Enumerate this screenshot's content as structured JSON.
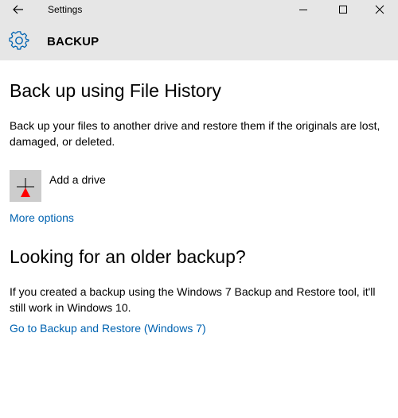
{
  "window": {
    "title": "Settings",
    "buttons": {
      "back_icon": "back-arrow-icon",
      "minimize_icon": "minimize-icon",
      "maximize_icon": "maximize-icon",
      "close_icon": "close-icon"
    }
  },
  "header": {
    "icon": "gear-icon",
    "title": "BACKUP"
  },
  "file_history": {
    "heading": "Back up using File History",
    "description": "Back up your files to another drive and restore them if the originals are lost, damaged, or deleted.",
    "add_drive_label": "Add a drive",
    "add_drive_icon": "add-plus-icon",
    "more_options_link": "More options"
  },
  "older_backup": {
    "heading": "Looking for an older backup?",
    "description": "If you created a backup using the Windows 7 Backup and Restore tool, it'll still work in Windows 10.",
    "restore_link": "Go to Backup and Restore (Windows 7)"
  },
  "colors": {
    "chrome": "#e6e6e6",
    "accent": "#0063b1",
    "tile": "#cccccc",
    "cursor_marker": "#ff0000"
  }
}
